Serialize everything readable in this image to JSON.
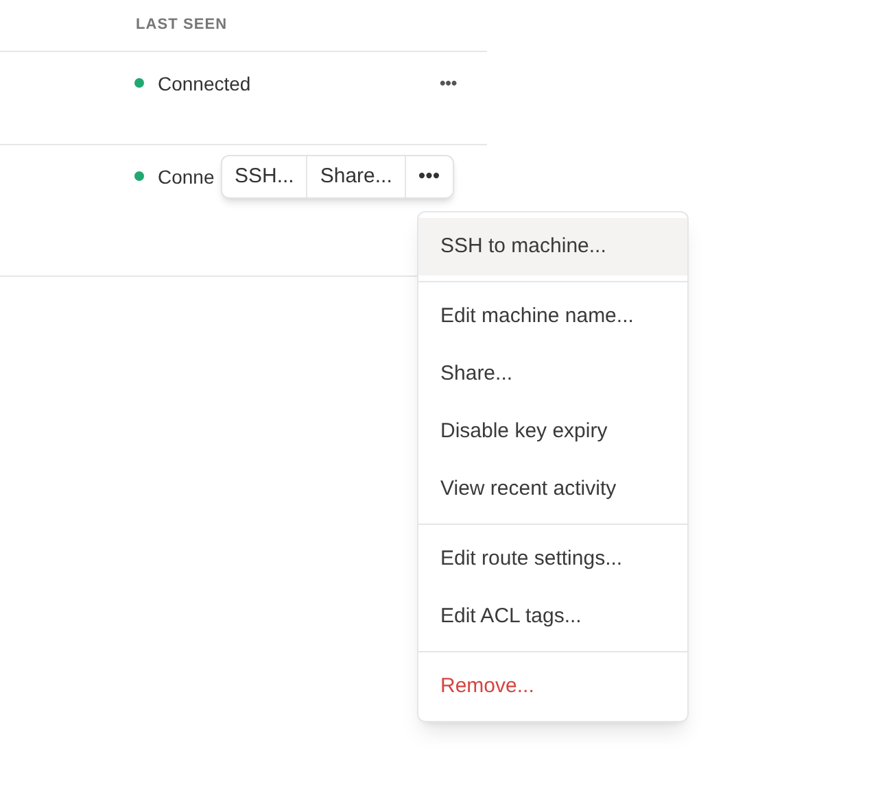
{
  "table": {
    "columns": [
      "LAST SEEN"
    ],
    "rows": [
      {
        "status": "Connected",
        "color": "#1fa971",
        "more": "•••"
      },
      {
        "status": "Conne",
        "color": "#1fa971",
        "toolbar": [
          "SSH...",
          "Share...",
          "•••"
        ]
      }
    ]
  },
  "menu": {
    "groups": [
      [
        {
          "label": "SSH to machine...",
          "selected": true,
          "kind": "normal"
        }
      ],
      [
        {
          "label": "Edit machine name...",
          "selected": false,
          "kind": "normal"
        },
        {
          "label": "Share...",
          "selected": false,
          "kind": "normal"
        },
        {
          "label": "Disable key expiry",
          "selected": false,
          "kind": "normal"
        },
        {
          "label": "View recent activity",
          "selected": false,
          "kind": "normal"
        }
      ],
      [
        {
          "label": "Edit route settings...",
          "selected": false,
          "kind": "normal"
        },
        {
          "label": "Edit ACL tags...",
          "selected": false,
          "kind": "normal"
        }
      ],
      [
        {
          "label": "Remove...",
          "selected": false,
          "kind": "danger"
        }
      ]
    ]
  }
}
